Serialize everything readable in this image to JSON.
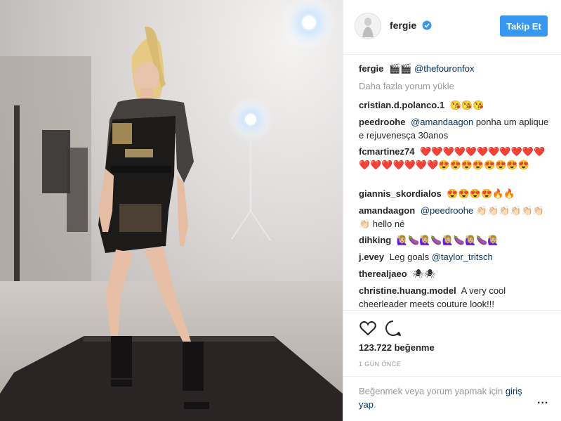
{
  "header": {
    "username": "fergie",
    "follow_label": "Takip Et"
  },
  "caption": {
    "user": "fergie",
    "emojis": "🎬🎬",
    "mention": "@thefouronfox"
  },
  "load_more": "Daha fazla yorum yükle",
  "comments": [
    {
      "user": "cristian.d.polanco.1",
      "mention": "",
      "text": "😘😘😘"
    },
    {
      "user": "peedroohe",
      "mention": "@amandaagon",
      "text": "ponha um aplique e rejuvenesça 30anos"
    },
    {
      "user": "fcmartinez74",
      "mention": "",
      "text": "❤️❤️❤️❤️❤️❤️❤️❤️❤️❤️❤️❤️❤️❤️❤️❤️❤️❤️😍😍😍😍😍😍😍😍"
    },
    {
      "user": "giannis_skordialos",
      "mention": "",
      "text": "😍😍😍😍🔥🔥"
    },
    {
      "user": "amandaagon",
      "mention": "@peedroohe",
      "text": "👏🏻👏🏻👏🏻👏🏻👏🏻👏🏻👏🏻 hello né"
    },
    {
      "user": "dihking",
      "mention": "",
      "text": "🙋🏼‍♀️🍆🙋🏼‍♀️🍆🙋🏼‍♀️🍆🙋🏼‍♀️🍆🙋🏼‍♀️"
    },
    {
      "user": "j.evey",
      "mention": "",
      "text": "Leg goals",
      "mention_after": "@taylor_tritsch"
    },
    {
      "user": "therealjaeo",
      "mention": "",
      "text": "🕷🕷"
    },
    {
      "user": "christine.huang.model",
      "mention": "",
      "text": "A very cool cheerleader meets couture look!!!"
    }
  ],
  "likes": "123.722 beğenme",
  "time": "1 GÜN ÖNCE",
  "login": {
    "text": "Beğenmek veya yorum yapmak için",
    "link": "giriş yap",
    "end": "."
  },
  "more_label": "...",
  "icons": {
    "heart": "heart-icon",
    "comment": "comment-icon",
    "verified": "verified-badge-icon"
  },
  "colors": {
    "accent": "#3897f0",
    "mention": "#003569",
    "muted": "#999999"
  }
}
